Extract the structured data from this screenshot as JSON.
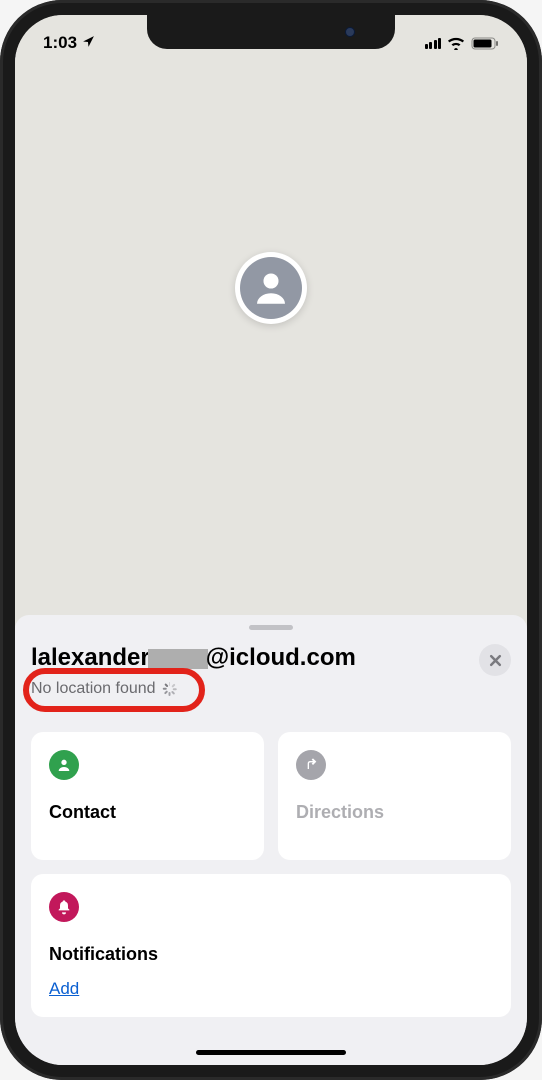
{
  "statusBar": {
    "time": "1:03"
  },
  "contact": {
    "emailPrefix": "lalexander",
    "emailSuffix": "@icloud.com",
    "status": "No location found"
  },
  "actions": {
    "contact": "Contact",
    "directions": "Directions"
  },
  "notifications": {
    "title": "Notifications",
    "addLabel": "Add"
  },
  "icons": {
    "locationArrow": "location-arrow",
    "person": "person",
    "turnArrow": "turn-arrow",
    "bell": "bell"
  },
  "colors": {
    "highlight": "#e2231a",
    "green": "#30a14e",
    "gray": "#a5a5ab",
    "redAccent": "#c2185b",
    "link": "#0a5fd1"
  }
}
